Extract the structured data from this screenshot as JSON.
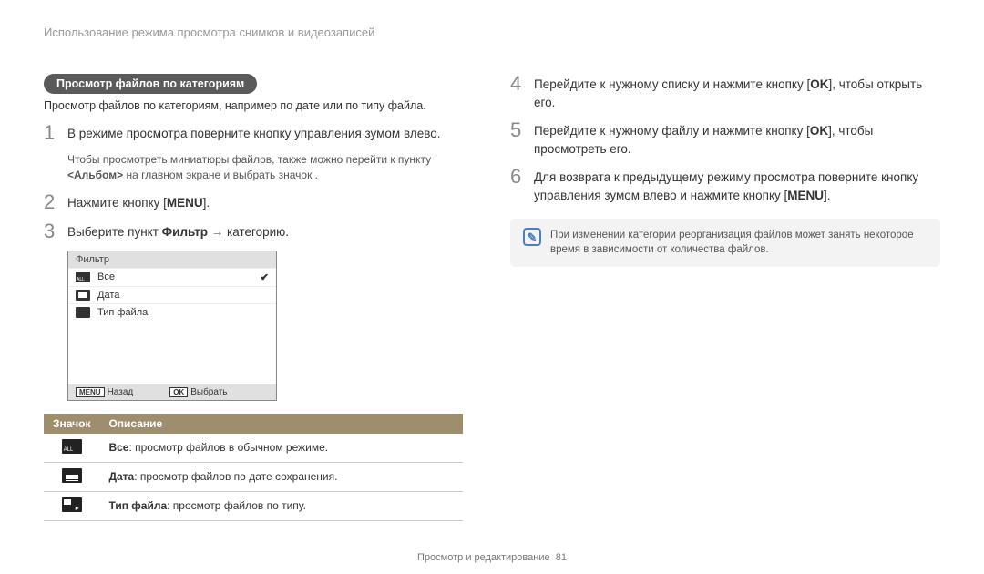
{
  "header": "Использование режима просмотра снимков и видеозаписей",
  "section_title": "Просмотр файлов по категориям",
  "intro": "Просмотр файлов по категориям, например по дате или по типу файла.",
  "steps_left": {
    "s1": "В режиме просмотра поверните кнопку управления зумом влево.",
    "s1_sub_a": "Чтобы просмотреть миниатюры файлов, также можно перейти к пункту",
    "s1_sub_b": "<Альбом>",
    "s1_sub_c": " на главном экране и выбрать значок      .",
    "s2_a": "Нажмите кнопку [",
    "s2_menu": "MENU",
    "s2_b": "].",
    "s3_a": "Выберите пункт ",
    "s3_bold": "Фильтр",
    "s3_b": " → категорию."
  },
  "screenshot": {
    "title": "Фильтр",
    "row1": "Все",
    "row2": "Дата",
    "row3": "Тип файла",
    "back_btn": "MENU",
    "back": "Назад",
    "sel_btn": "OK",
    "select": "Выбрать"
  },
  "legend": {
    "h1": "Значок",
    "h2": "Описание",
    "r1_b": "Все",
    "r1": ": просмотр файлов в обычном режиме.",
    "r2_b": "Дата",
    "r2": ": просмотр файлов по дате сохранения.",
    "r3_b": "Тип файла",
    "r3": ": просмотр файлов по типу."
  },
  "steps_right": {
    "s4_a": "Перейдите к нужному списку и нажмите кнопку [",
    "s4_ok": "OK",
    "s4_b": "], чтобы открыть его.",
    "s5_a": "Перейдите к нужному файлу и нажмите кнопку [",
    "s5_ok": "OK",
    "s5_b": "], чтобы просмотреть его.",
    "s6_a": "Для возврата к предыдущему режиму просмотра поверните кнопку управления зумом влево и нажмите кнопку [",
    "s6_menu": "MENU",
    "s6_b": "]."
  },
  "note": "При изменении категории реорганизация файлов может занять некоторое время в зависимости от количества файлов.",
  "footer_text": "Просмотр и редактирование",
  "footer_page": "81"
}
